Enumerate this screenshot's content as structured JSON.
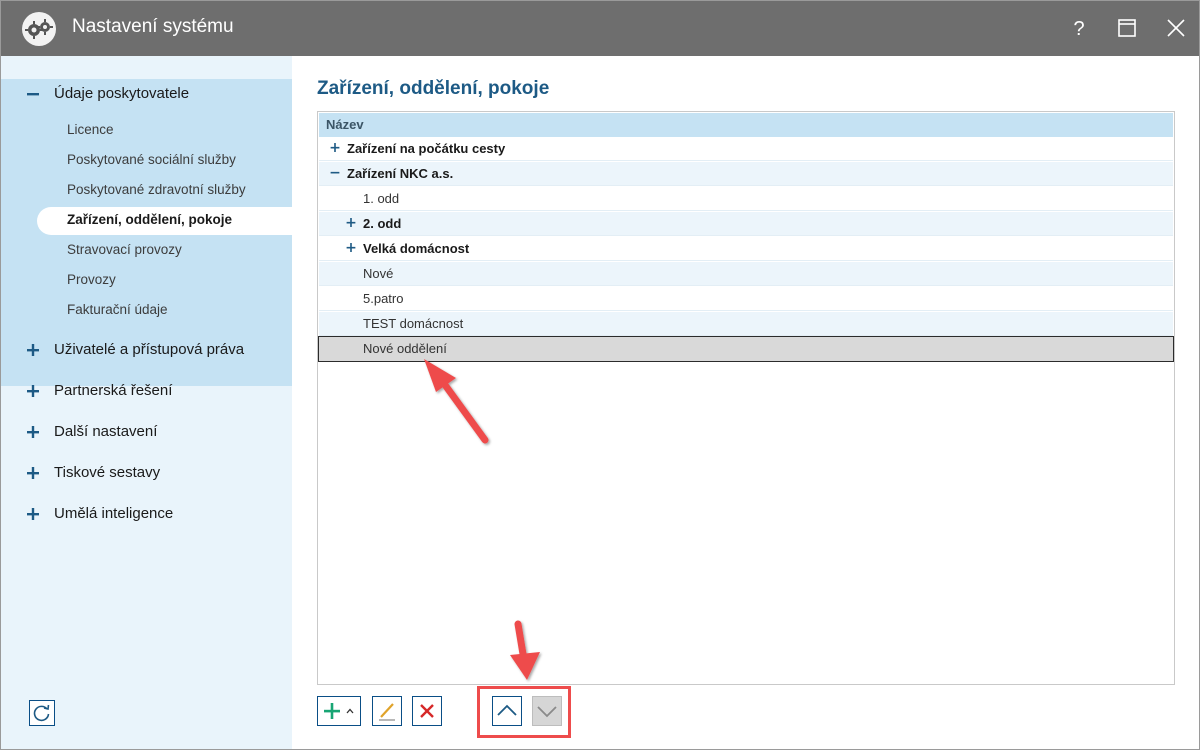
{
  "window": {
    "title": "Nastavení systému",
    "controls": {
      "help": "?",
      "maximize": "maximize-icon",
      "close": "close-icon"
    }
  },
  "sidebar": {
    "sections": [
      {
        "label": "Údaje poskytovatele",
        "expanded": true,
        "items": [
          {
            "label": "Licence"
          },
          {
            "label": "Poskytované sociální služby"
          },
          {
            "label": "Poskytované zdravotní služby"
          },
          {
            "label": "Zařízení, oddělení, pokoje",
            "active": true
          },
          {
            "label": "Stravovací provozy"
          },
          {
            "label": "Provozy"
          },
          {
            "label": "Fakturační údaje"
          }
        ]
      },
      {
        "label": "Uživatelé a přístupová práva",
        "expanded": false
      },
      {
        "label": "Partnerská řešení",
        "expanded": false
      },
      {
        "label": "Další nastavení",
        "expanded": false
      },
      {
        "label": "Tiskové sestavy",
        "expanded": false
      },
      {
        "label": "Umělá inteligence",
        "expanded": false
      }
    ],
    "refresh_icon": "refresh-icon"
  },
  "main": {
    "title": "Zařízení, oddělení, pokoje",
    "grid": {
      "column_header": "Název",
      "rows": [
        {
          "label": "Zařízení na počátku cesty",
          "expander": "+",
          "level": 0,
          "bold": true
        },
        {
          "label": "Zařízení NKC a.s.",
          "expander": "−",
          "level": 0,
          "bold": true
        },
        {
          "label": "1. odd",
          "expander": "",
          "level": 1,
          "bold": false
        },
        {
          "label": "2. odd",
          "expander": "+",
          "level": 1,
          "bold": true
        },
        {
          "label": "Velká domácnost",
          "expander": "+",
          "level": 1,
          "bold": true
        },
        {
          "label": "Nové",
          "expander": "",
          "level": 1,
          "bold": false
        },
        {
          "label": "5.patro",
          "expander": "",
          "level": 1,
          "bold": false
        },
        {
          "label": "TEST domácnost",
          "expander": "",
          "level": 1,
          "bold": false
        },
        {
          "label": "Nové oddělení",
          "expander": "",
          "level": 1,
          "bold": false,
          "selected": true
        }
      ]
    },
    "toolbar": {
      "add_icon": "plus-icon",
      "add_menu_icon": "caret-up-icon",
      "edit_icon": "pencil-icon",
      "delete_icon": "delete-x-icon",
      "move_up_icon": "chevron-up-icon",
      "move_down_icon": "chevron-down-icon"
    }
  },
  "colors": {
    "titlebar": "#6e6e6e",
    "sidebar_bg": "#e9f4fb",
    "sidebar_section_bg": "#c5e2f3",
    "accent": "#1d5a85",
    "annotation_red": "#ee4c4c"
  }
}
